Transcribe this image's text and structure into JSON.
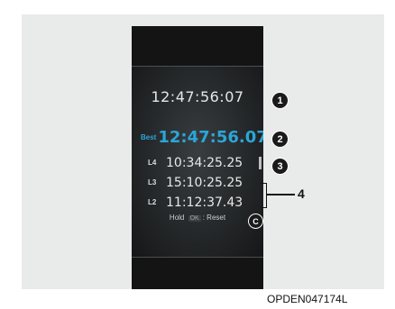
{
  "display": {
    "current_time": "12:47:56:07",
    "best": {
      "label": "Best",
      "time": "12:47:56.07"
    },
    "laps": [
      {
        "label": "L4",
        "time": "10:34:25.25"
      },
      {
        "label": "L3",
        "time": "15:10:25.25"
      },
      {
        "label": "L2",
        "time": "11:12:37.43"
      }
    ],
    "hint": {
      "hold": "Hold",
      "ok": "OK",
      "reset": ": Reset"
    }
  },
  "callouts": {
    "one": "1",
    "two": "2",
    "three": "3",
    "four": "4",
    "c": "C"
  },
  "figure_code": "OPDEN047174L",
  "colors": {
    "best_accent": "#2aa6d8",
    "screen_bg": "#141414",
    "panel_bg": "#e9eaea"
  }
}
